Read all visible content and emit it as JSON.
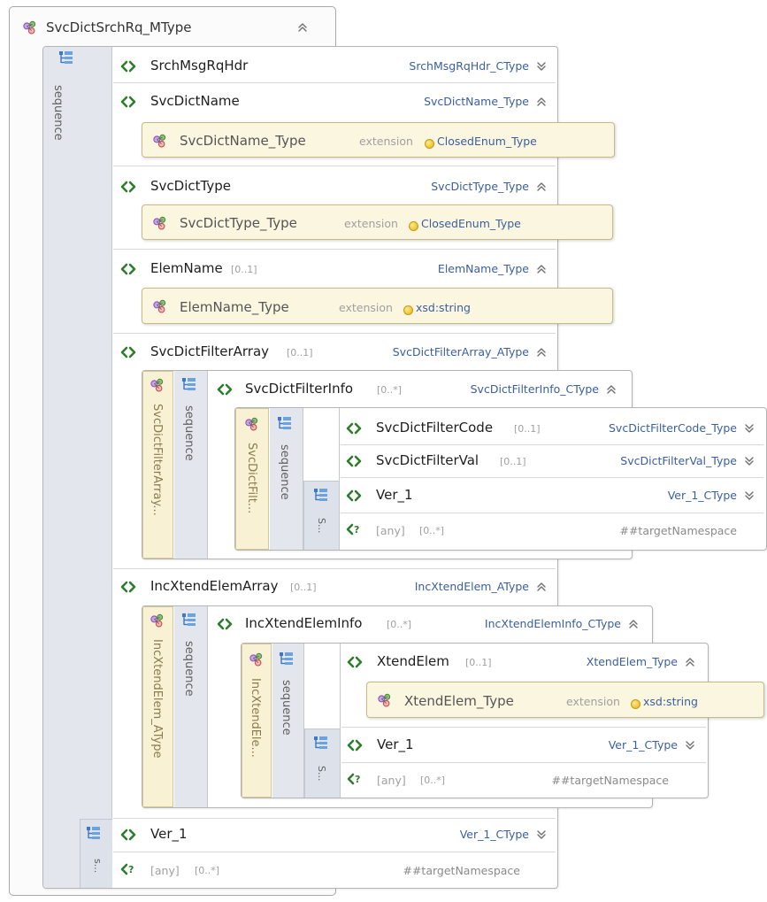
{
  "root": {
    "name": "SvcDictSrchRq_MType",
    "chevron": "»"
  },
  "outer_sequence": {
    "label": "sequence",
    "sublabel": "s..."
  },
  "elements": {
    "srch_msg_rq_hdr": {
      "name": "SrchMsgRqHdr",
      "type": "SrchMsgRqHdr_CType",
      "chevron": "»"
    },
    "svc_dict_name": {
      "name": "SvcDictName",
      "type": "SvcDictName_Type",
      "chevron": "»",
      "ext": {
        "name": "SvcDictName_Type",
        "keyword": "extension",
        "base": "ClosedEnum_Type"
      }
    },
    "svc_dict_type": {
      "name": "SvcDictType",
      "type": "SvcDictType_Type",
      "chevron": "»",
      "ext": {
        "name": "SvcDictType_Type",
        "keyword": "extension",
        "base": "ClosedEnum_Type"
      }
    },
    "elem_name": {
      "name": "ElemName",
      "card": "[0..1]",
      "type": "ElemName_Type",
      "chevron": "»",
      "ext": {
        "name": "ElemName_Type",
        "keyword": "extension",
        "base": "xsd:string"
      }
    },
    "filter_array": {
      "name": "SvcDictFilterArray",
      "card": "[0..1]",
      "type": "SvcDictFilterArray_AType",
      "chevron": "»",
      "strip_label": "SvcDictFilterArray...",
      "seq_label": "sequence",
      "info": {
        "name": "SvcDictFilterInfo",
        "card": "[0..*]",
        "type": "SvcDictFilterInfo_CType",
        "chevron": "»",
        "strip_label": "SvcDictFilt...",
        "seq_label": "sequence",
        "sublabel": "S...",
        "rows": [
          {
            "name": "SvcDictFilterCode",
            "card": "[0..1]",
            "type": "SvcDictFilterCode_Type",
            "chevron": "»"
          },
          {
            "name": "SvcDictFilterVal",
            "card": "[0..1]",
            "type": "SvcDictFilterVal_Type",
            "chevron": "»"
          },
          {
            "name": "Ver_1",
            "type": "Ver_1_CType",
            "chevron": "»"
          }
        ],
        "any": {
          "name": "[any]",
          "card": "[0..*]",
          "ns": "##targetNamespace"
        }
      }
    },
    "xtend_array": {
      "name": "IncXtendElemArray",
      "card": "[0..1]",
      "type": "IncXtendElem_AType",
      "chevron": "»",
      "strip_label": "IncXtendElem_AType",
      "seq_label": "sequence",
      "info": {
        "name": "IncXtendElemInfo",
        "card": "[0..*]",
        "type": "IncXtendElemInfo_CType",
        "chevron": "»",
        "strip_label": "IncXtendEle...",
        "seq_label": "sequence",
        "sublabel": "S...",
        "xtend": {
          "name": "XtendElem",
          "card": "[0..1]",
          "type": "XtendElem_Type",
          "chevron": "»",
          "ext": {
            "name": "XtendElem_Type",
            "keyword": "extension",
            "base": "xsd:string"
          }
        },
        "ver": {
          "name": "Ver_1",
          "type": "Ver_1_CType",
          "chevron": "»"
        },
        "any": {
          "name": "[any]",
          "card": "[0..*]",
          "ns": "##targetNamespace"
        }
      }
    },
    "ver_1": {
      "name": "Ver_1",
      "type": "Ver_1_CType",
      "chevron": "»"
    },
    "any": {
      "name": "[any]",
      "card": "[0..*]",
      "ns": "##targetNamespace"
    }
  }
}
